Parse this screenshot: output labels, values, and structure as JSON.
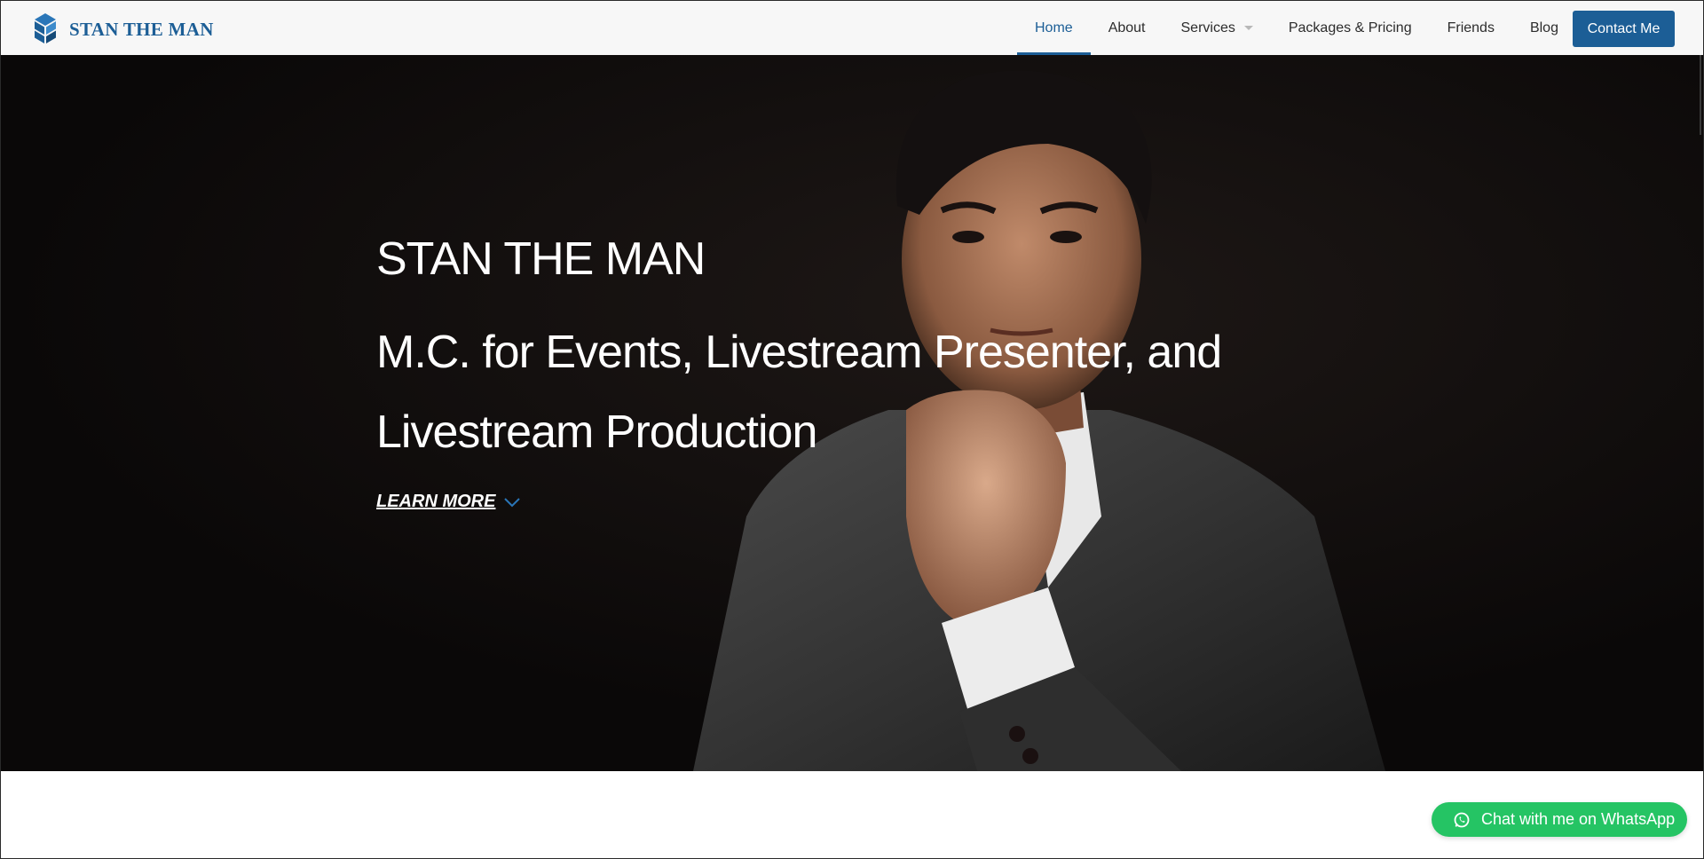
{
  "header": {
    "logo_text": "STAN THE MAN",
    "nav": [
      {
        "label": "Home",
        "active": true
      },
      {
        "label": "About"
      },
      {
        "label": "Services",
        "has_dropdown": true
      },
      {
        "label": "Packages & Pricing"
      },
      {
        "label": "Friends"
      },
      {
        "label": "Blog"
      }
    ],
    "contact_button": "Contact Me"
  },
  "hero": {
    "title": "STAN THE MAN",
    "subtitle": "M.C. for Events, Livestream Presenter, and Livestream Production",
    "learn_more": "LEARN MORE"
  },
  "whatsapp": {
    "label": "Chat with me on WhatsApp",
    "icon": "whatsapp-icon"
  },
  "colors": {
    "brand": "#1c5e96",
    "hero_bg": "#0b0909",
    "whatsapp": "#25c464"
  }
}
